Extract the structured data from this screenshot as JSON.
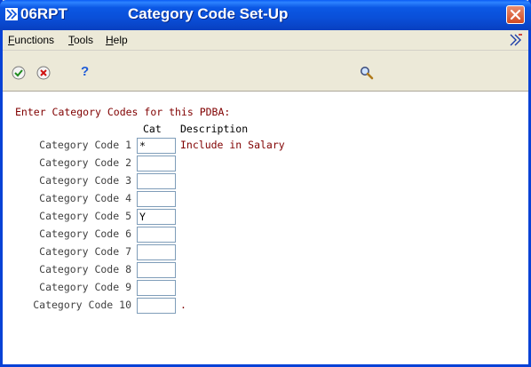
{
  "window": {
    "app_name": "06RPT",
    "title": "Category Code Set-Up"
  },
  "menu": {
    "items": [
      {
        "underlined": "F",
        "rest": "unctions"
      },
      {
        "underlined": "T",
        "rest": "ools"
      },
      {
        "underlined": "H",
        "rest": "elp"
      }
    ]
  },
  "toolbar": {
    "icons": [
      "ok-check-icon",
      "cancel-x-icon",
      "help-question-icon",
      "search-magnifier-icon"
    ],
    "help_glyph": "?"
  },
  "form": {
    "instruction": "Enter Category Codes for this PDBA:",
    "col_cat": "Cat",
    "col_description": "Description",
    "rows": [
      {
        "label": "Category Code 1",
        "value": "*",
        "description": "Include in Salary"
      },
      {
        "label": "Category Code 2",
        "value": "",
        "description": ""
      },
      {
        "label": "Category Code 3",
        "value": "",
        "description": ""
      },
      {
        "label": "Category Code 4",
        "value": "",
        "description": ""
      },
      {
        "label": "Category Code 5",
        "value": "Y",
        "description": ""
      },
      {
        "label": "Category Code 6",
        "value": "",
        "description": ""
      },
      {
        "label": "Category Code 7",
        "value": "",
        "description": ""
      },
      {
        "label": "Category Code 8",
        "value": "",
        "description": ""
      },
      {
        "label": "Category Code 9",
        "value": "",
        "description": ""
      },
      {
        "label": "Category Code 10",
        "value": "",
        "description": "."
      }
    ]
  }
}
